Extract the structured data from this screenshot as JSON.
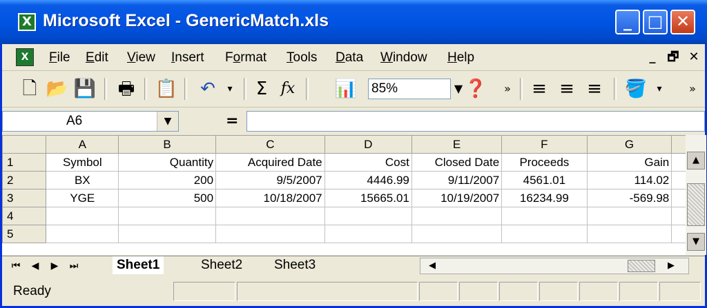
{
  "window": {
    "title": "Microsoft Excel - GenericMatch.xls",
    "app_icon": "excel-icon",
    "controls": {
      "minimize": "_",
      "maximize": "□",
      "close": "✕"
    }
  },
  "menubar": {
    "items": [
      {
        "label": "File",
        "accel": "F",
        "rest": "ile"
      },
      {
        "label": "Edit",
        "accel": "E",
        "rest": "dit"
      },
      {
        "label": "View",
        "accel": "V",
        "rest": "iew"
      },
      {
        "label": "Insert",
        "accel": "I",
        "rest": "nsert"
      },
      {
        "label": "Format",
        "pre": "F",
        "accel": "o",
        "rest": "rmat"
      },
      {
        "label": "Tools",
        "accel": "T",
        "rest": "ools"
      },
      {
        "label": "Data",
        "accel": "D",
        "rest": "ata"
      },
      {
        "label": "Window",
        "accel": "W",
        "rest": "indow"
      },
      {
        "label": "Help",
        "accel": "H",
        "rest": "elp"
      }
    ],
    "doc_controls": {
      "minimize": "_",
      "restore": "🗗",
      "close": "✕"
    }
  },
  "toolbar": {
    "zoom": "85%",
    "sum_symbol": "Σ",
    "fx_symbol": "fx"
  },
  "formula_bar": {
    "name_box": "A6",
    "equals": "=",
    "formula": ""
  },
  "sheet": {
    "columns": [
      "A",
      "B",
      "C",
      "D",
      "E",
      "F",
      "G"
    ],
    "rows": [
      {
        "num": "1",
        "cells": [
          "Symbol",
          "Quantity",
          "Acquired Date",
          "Cost",
          "Closed Date",
          "Proceeds",
          "Gain"
        ]
      },
      {
        "num": "2",
        "cells": [
          "BX",
          "200",
          "9/5/2007",
          "4446.99",
          "9/11/2007",
          "4561.01",
          "114.02"
        ]
      },
      {
        "num": "3",
        "cells": [
          "YGE",
          "500",
          "10/18/2007",
          "15665.01",
          "10/19/2007",
          "16234.99",
          "-569.98"
        ]
      },
      {
        "num": "4",
        "cells": [
          "",
          "",
          "",
          "",
          "",
          "",
          ""
        ]
      },
      {
        "num": "5",
        "cells": [
          "",
          "",
          "",
          "",
          "",
          "",
          ""
        ]
      }
    ]
  },
  "tabs": {
    "items": [
      "Sheet1",
      "Sheet2",
      "Sheet3"
    ],
    "active": "Sheet1"
  },
  "status": {
    "text": "Ready"
  }
}
